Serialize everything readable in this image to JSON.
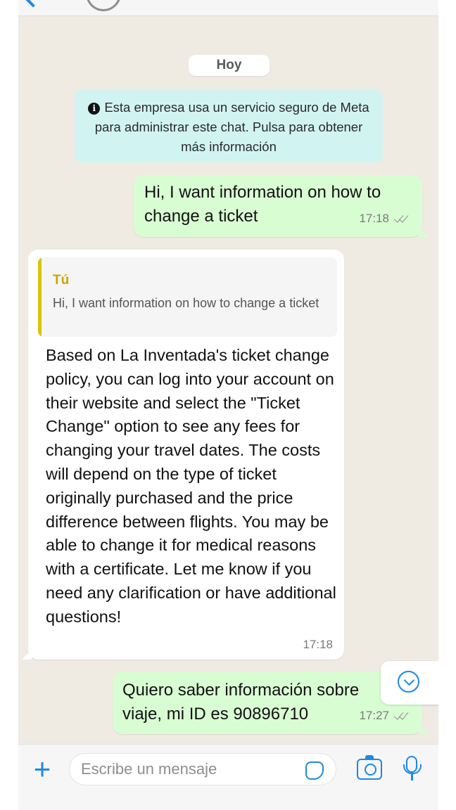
{
  "date_separator": "Hoy",
  "system_notice": {
    "icon": "info-icon",
    "text": "Esta empresa usa un servicio seguro de Meta para administrar este chat. Pulsa para obtener más información"
  },
  "messages": [
    {
      "direction": "outgoing",
      "text": "Hi, I want information on how to change a ticket",
      "time": "17:18",
      "status": "read-ticks"
    },
    {
      "direction": "incoming",
      "quoted_author": "Tú",
      "quoted_text": "Hi, I want information on how to change a ticket",
      "text": "Based on La Inventada's ticket change policy, you can log into your account on their website and select the \"Ticket Change\" option to see any fees for changing your travel dates. The costs will depend on the type of ticket originally purchased and the price difference between flights. You may be able to change it for medical reasons with a certificate. Let me know if you need any clarification or have additional questions!",
      "time": "17:18"
    },
    {
      "direction": "outgoing",
      "text": "Quiero saber información sobre viaje, mi ID es 90896710",
      "time": "17:27",
      "status": "read-ticks"
    }
  ],
  "composer": {
    "placeholder": "Escribe un mensaje",
    "icons": [
      "plus-icon",
      "sticker-icon",
      "camera-icon",
      "microphone-icon"
    ]
  },
  "colors": {
    "accent": "#1e88e5",
    "outgoing_bubble": "#d9fdd3",
    "system_notice": "#d1f4f2",
    "quote_bar": "#d9c400"
  }
}
